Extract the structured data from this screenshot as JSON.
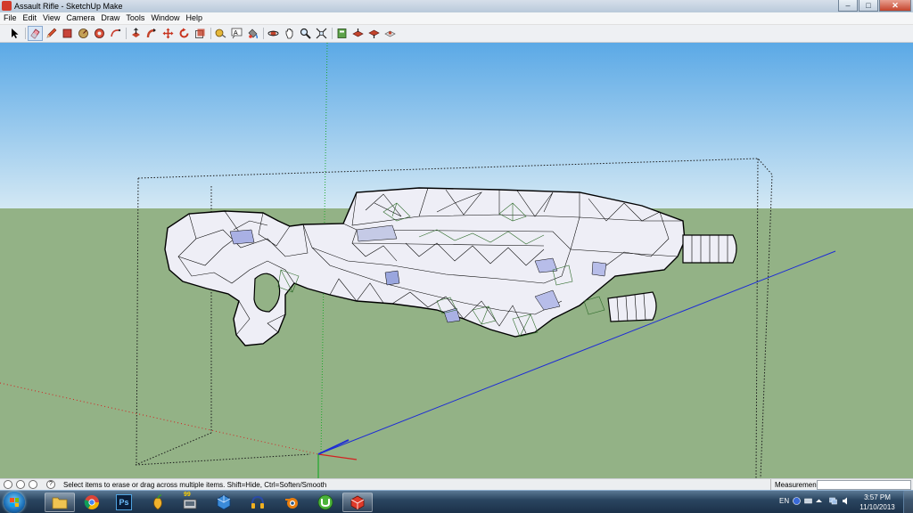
{
  "window": {
    "title": "Assault Rifle - SketchUp Make",
    "minimize": "–",
    "maximize": "□",
    "close": "✕"
  },
  "menu": [
    "File",
    "Edit",
    "View",
    "Camera",
    "Draw",
    "Tools",
    "Window",
    "Help"
  ],
  "toolbar": {
    "tools": [
      {
        "name": "select-tool",
        "icon": "arrow-icon"
      },
      {
        "name": "eraser-tool",
        "icon": "eraser-icon",
        "active": true
      },
      {
        "name": "line-tool",
        "icon": "pencil-icon"
      },
      {
        "name": "rectangle-tool",
        "icon": "rectangle-icon"
      },
      {
        "name": "circle-tool",
        "icon": "circle-icon"
      },
      {
        "name": "polygon-tool",
        "icon": "polygon-icon"
      },
      {
        "name": "arc-tool",
        "icon": "arc-icon"
      },
      {
        "name": "push-pull-tool",
        "icon": "push-pull-icon"
      },
      {
        "name": "follow-me-tool",
        "icon": "follow-me-icon"
      },
      {
        "name": "move-tool",
        "icon": "move-icon"
      },
      {
        "name": "rotate-tool",
        "icon": "rotate-icon"
      },
      {
        "name": "scale-tool",
        "icon": "scale-icon"
      },
      {
        "name": "tape-measure-tool",
        "icon": "tape-icon"
      },
      {
        "name": "text-tool",
        "icon": "text-icon"
      },
      {
        "name": "paint-bucket-tool",
        "icon": "paint-bucket-icon"
      },
      {
        "name": "orbit-tool",
        "icon": "orbit-icon"
      },
      {
        "name": "pan-tool",
        "icon": "hand-icon"
      },
      {
        "name": "zoom-tool",
        "icon": "magnifier-icon"
      },
      {
        "name": "zoom-extents-tool",
        "icon": "zoom-extents-icon"
      },
      {
        "name": "warehouse-tool",
        "icon": "warehouse-icon"
      },
      {
        "name": "share-model-tool",
        "icon": "share-icon"
      },
      {
        "name": "get-models-tool",
        "icon": "models-icon"
      },
      {
        "name": "extension-warehouse-tool",
        "icon": "extension-icon"
      }
    ]
  },
  "status": {
    "hint": "Select items to erase or drag across multiple items. Shift=Hide, Ctrl=Soften/Smooth",
    "help_icon": "?",
    "measurements_label": "Measurements",
    "measurements_value": ""
  },
  "taskbar": {
    "apps": [
      {
        "name": "explorer-app",
        "icon": "folder-icon",
        "running": true
      },
      {
        "name": "chrome-app",
        "icon": "chrome-icon",
        "running": false
      },
      {
        "name": "photoshop-app",
        "icon": "photoshop-icon",
        "label": "Ps",
        "running": false
      },
      {
        "name": "fl-studio-app",
        "icon": "fruit-icon",
        "running": false
      },
      {
        "name": "hardware-app",
        "icon": "hardware-icon",
        "badge": "99",
        "running": false
      },
      {
        "name": "vmware-app",
        "icon": "cube-icon",
        "running": false
      },
      {
        "name": "headphones-app",
        "icon": "headphones-icon",
        "running": false
      },
      {
        "name": "blender-app",
        "icon": "blender-icon",
        "running": false
      },
      {
        "name": "utorrent-app",
        "icon": "utorrent-icon",
        "running": false
      },
      {
        "name": "sketchup-app",
        "icon": "sketchup-icon",
        "running": true
      }
    ],
    "language": "EN",
    "time": "3:57 PM",
    "date": "11/10/2013"
  },
  "colors": {
    "sky_top": "#5ba9e6",
    "sky_bottom": "#d3e8f4",
    "ground": "#93b286",
    "model_fill": "#eeeef6",
    "model_edge": "#000000",
    "axis_blue": "#1d2bd6",
    "axis_red": "#d42020",
    "axis_green": "#1fa82c",
    "accent_active_tool": "#d8e6f6"
  }
}
